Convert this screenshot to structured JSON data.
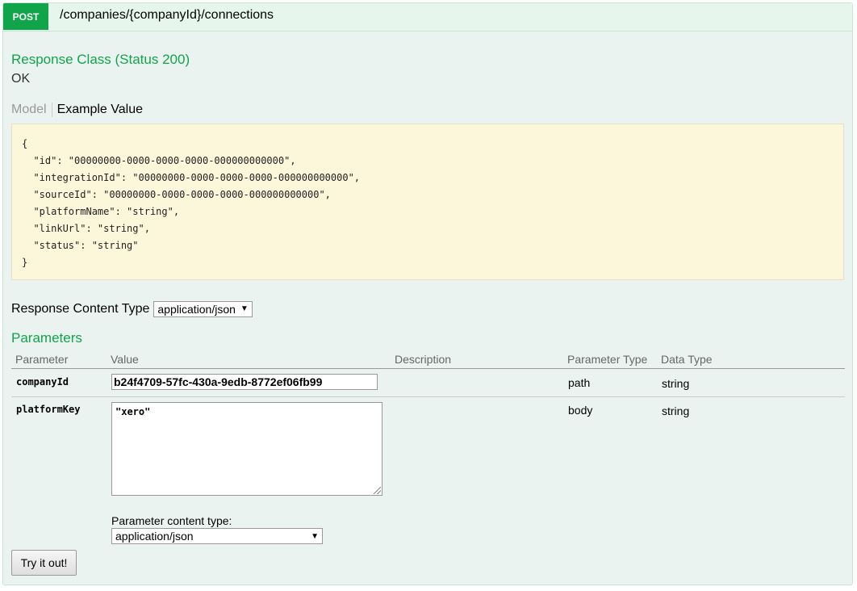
{
  "operation": {
    "method": "POST",
    "path": "/companies/{companyId}/connections"
  },
  "response": {
    "class_title": "Response Class (Status 200)",
    "status_text": "OK",
    "tabs": {
      "model": "Model",
      "example": "Example Value"
    },
    "example_json": "{\n  \"id\": \"00000000-0000-0000-0000-000000000000\",\n  \"integrationId\": \"00000000-0000-0000-0000-000000000000\",\n  \"sourceId\": \"00000000-0000-0000-0000-000000000000\",\n  \"platformName\": \"string\",\n  \"linkUrl\": \"string\",\n  \"status\": \"string\"\n}",
    "content_type_label": "Response Content Type",
    "content_type_value": "application/json"
  },
  "parameters": {
    "title": "Parameters",
    "headers": {
      "parameter": "Parameter",
      "value": "Value",
      "description": "Description",
      "parameter_type": "Parameter Type",
      "data_type": "Data Type"
    },
    "rows": [
      {
        "name": "companyId",
        "value": "b24f4709-57fc-430a-9edb-8772ef06fb99",
        "description": "",
        "parameter_type": "path",
        "data_type": "string"
      },
      {
        "name": "platformKey",
        "value": "\"xero\"",
        "description": "",
        "parameter_type": "body",
        "data_type": "string"
      }
    ],
    "content_type_label": "Parameter content type:",
    "content_type_value": "application/json"
  },
  "actions": {
    "try_label": "Try it out!"
  },
  "colors": {
    "post_green": "#10a54a",
    "panel_bg": "#ebf3f0",
    "example_bg": "#fcf6db"
  }
}
